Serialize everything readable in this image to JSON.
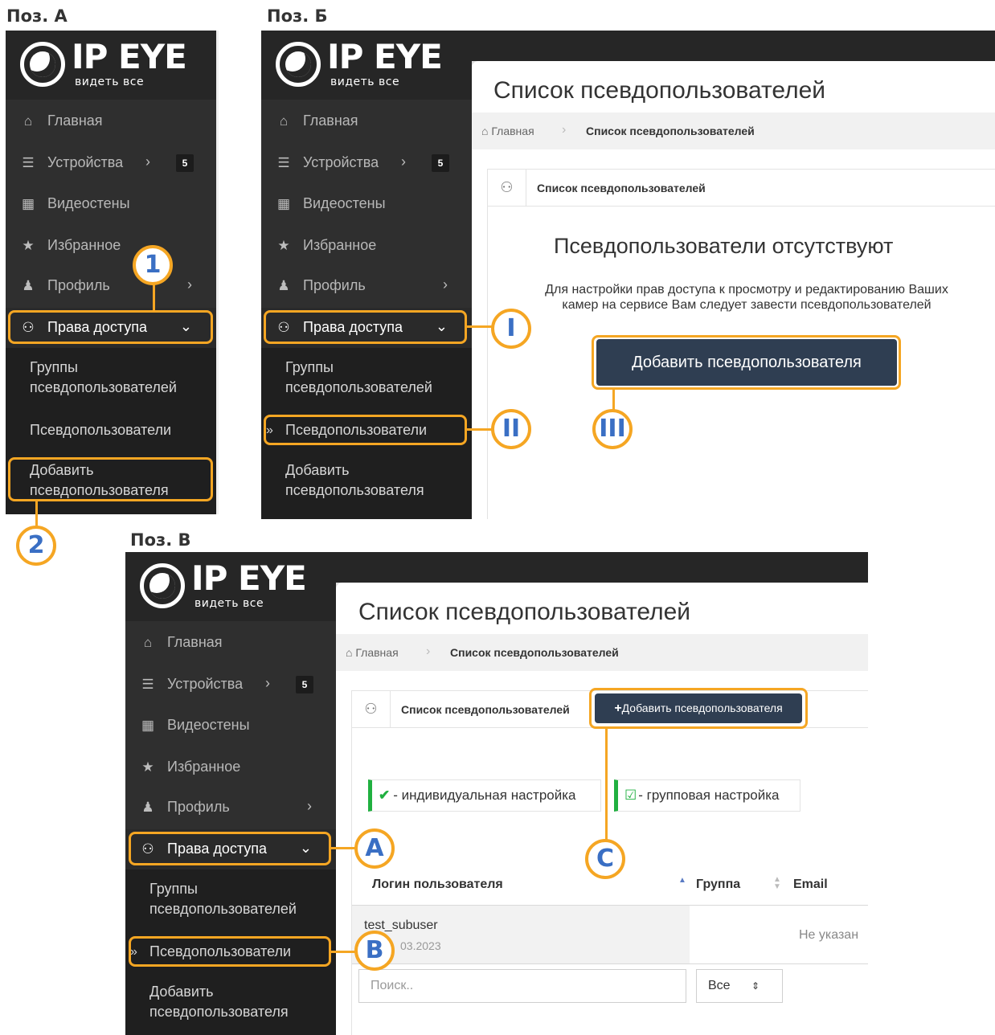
{
  "positions": {
    "a": "Поз. А",
    "b": "Поз. Б",
    "c": "Поз. В"
  },
  "logo": {
    "brand": "IP EYE",
    "tagline": "видеть все"
  },
  "nav": {
    "home": "Главная",
    "devices": "Устройства",
    "devices_badge": "5",
    "videowalls": "Видеостены",
    "favorites": "Избранное",
    "profile": "Профиль",
    "access": "Права доступа",
    "sub_groups": "Группы псевдопользователей",
    "sub_pseudo": "Псевдопользователи",
    "sub_add": "Добавить псевдопользователя"
  },
  "icons": {
    "home": "home-icon",
    "devices": "list-icon",
    "videowalls": "grid-icon",
    "favorites": "star-icon",
    "profile": "user-icon",
    "access": "users-icon",
    "chevron_right": "chevron-right-icon",
    "chevron_down": "chevron-down-icon"
  },
  "content": {
    "page_title": "Список псевдопользователей",
    "breadcrumb_home": "Главная",
    "breadcrumb_current": "Список псевдопользователей",
    "box_title": "Список псевдопользователей",
    "empty_title": "Псевдопользователи отсутствуют",
    "empty_text_1": "Для настройки прав доступа к просмотру и редактированию Ваших",
    "empty_text_2": "камер на сервисе Вам следует завести псевдопользователей",
    "add_button": "Добавить псевдопользователя",
    "add_button_small": "Добавить псевдопользователя",
    "legend_individual": "- индивидуальная настройка",
    "legend_group": "- групповая настройка",
    "col_login": "Логин пользователя",
    "col_group": "Группа",
    "col_email": "Email",
    "row_login": "test_subuser",
    "row_date": "03.2023",
    "row_email": "Не указан",
    "search_placeholder": "Поиск..",
    "filter_value": "Все"
  },
  "markers": {
    "m1": "1",
    "m2": "2",
    "mI": "I",
    "mII": "II",
    "mIII": "III",
    "mA": "A",
    "mB": "B",
    "mC": "C"
  },
  "colors": {
    "highlight": "#f5a623",
    "marker_text": "#3a6fc4",
    "button": "#2f3e52",
    "sidebar": "#2f2f2f"
  }
}
